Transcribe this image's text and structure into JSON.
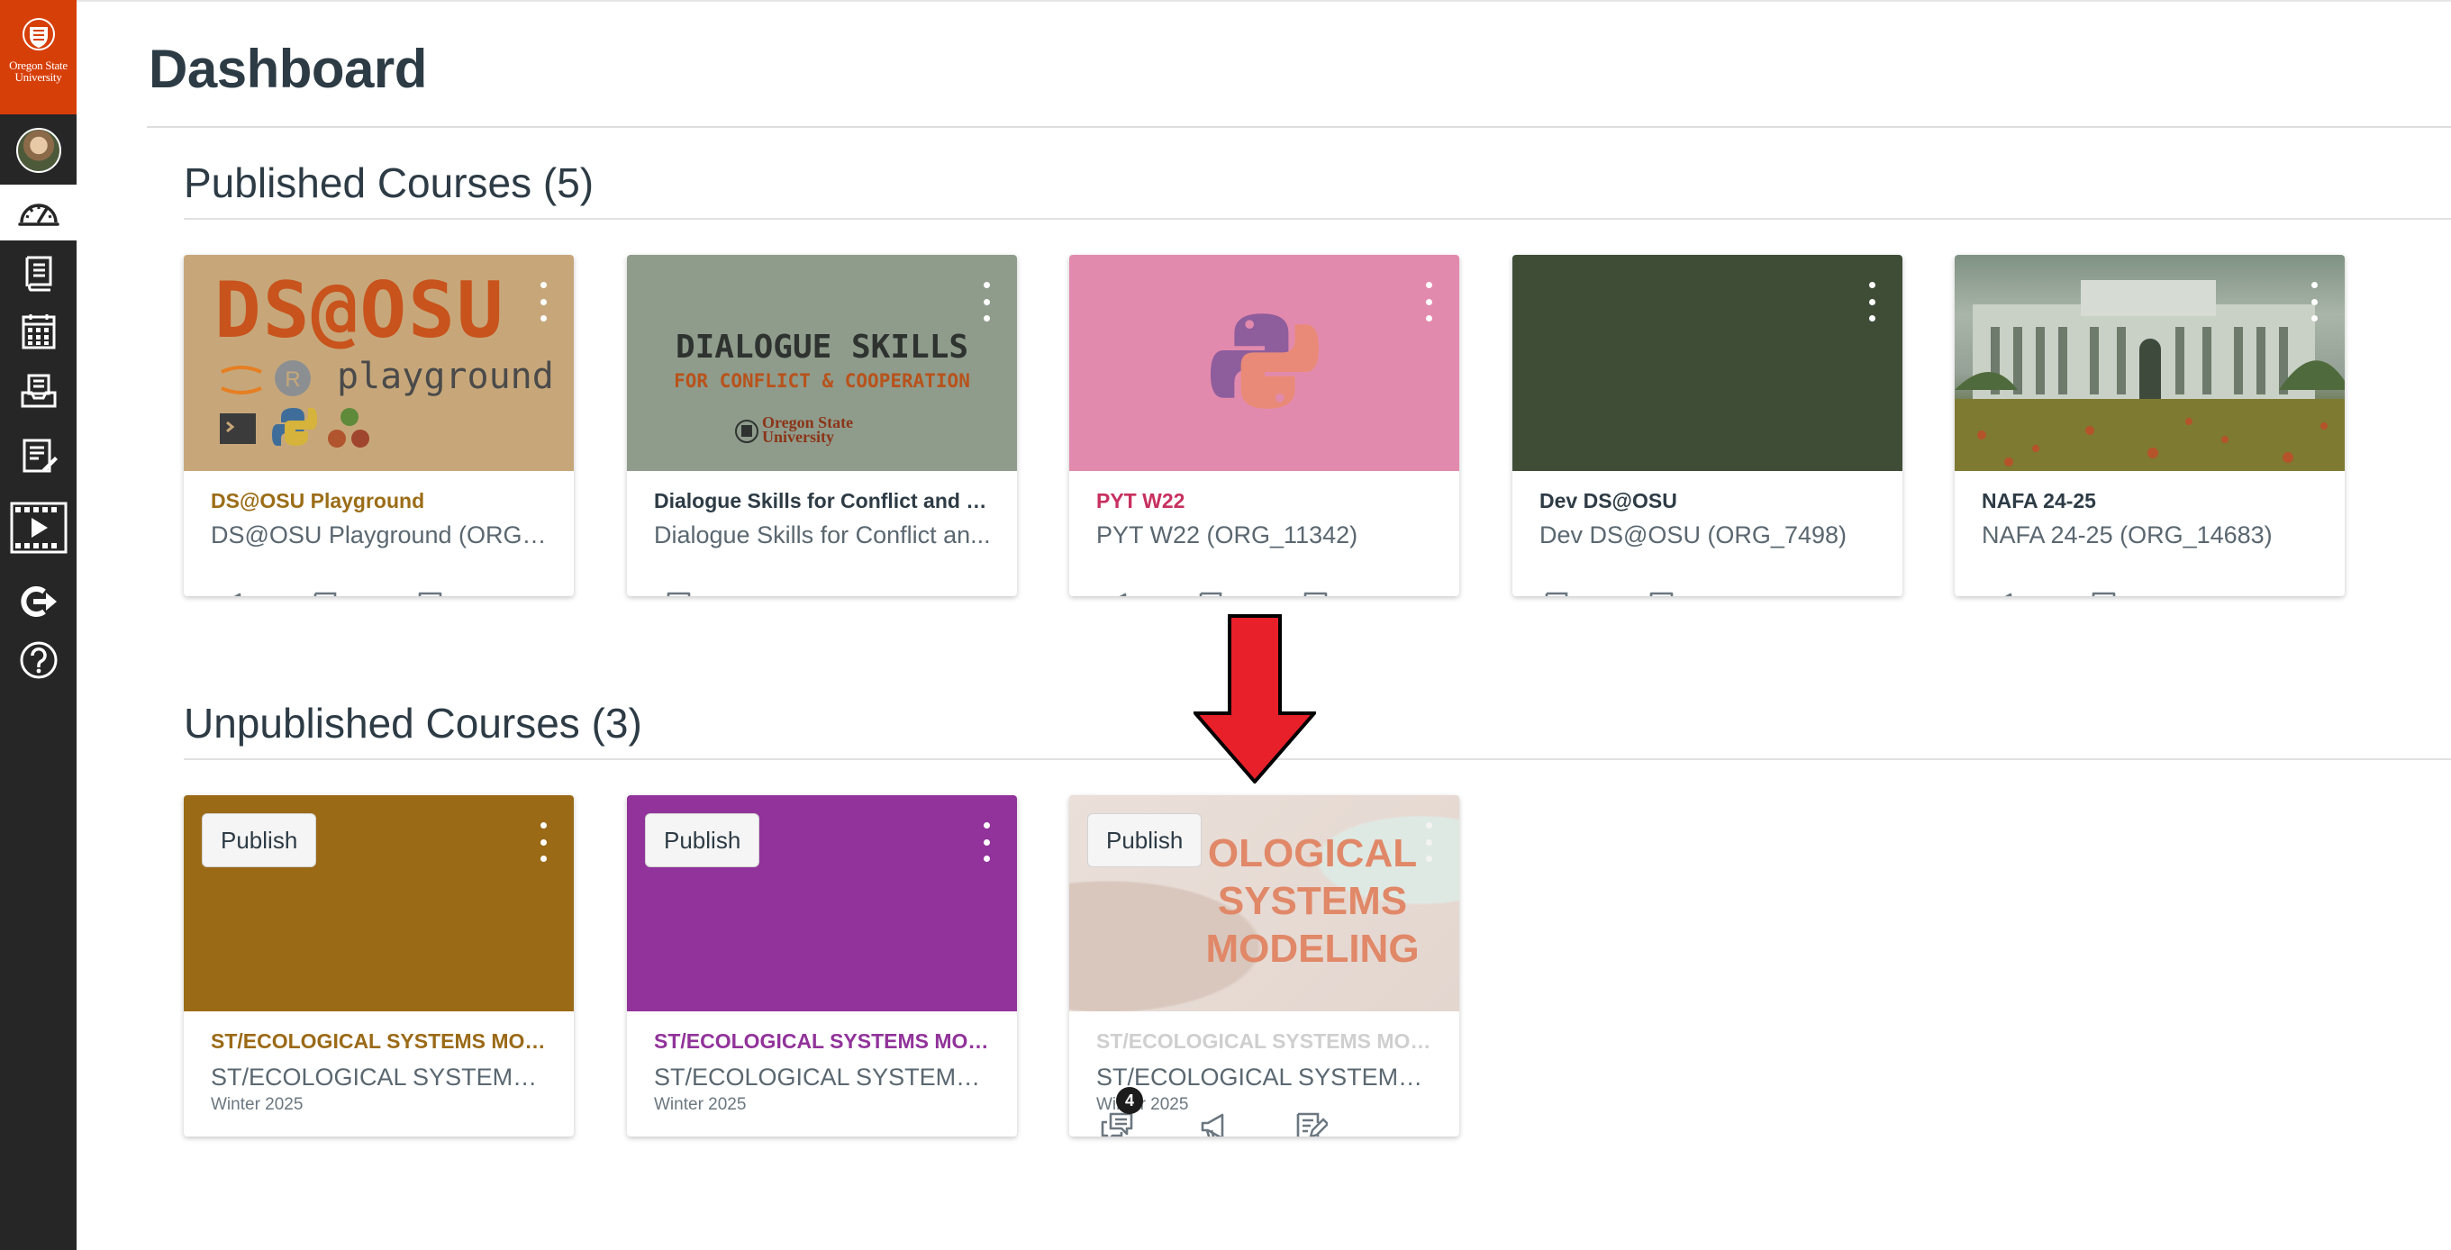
{
  "nav": {
    "logo_line1": "Oregon State",
    "logo_line2": "University",
    "items": [
      {
        "icon": "dashboard-icon"
      },
      {
        "icon": "courses-icon"
      },
      {
        "icon": "calendar-icon"
      },
      {
        "icon": "inbox-icon"
      },
      {
        "icon": "history-icon"
      },
      {
        "icon": "studio-icon"
      },
      {
        "icon": "logout-icon"
      },
      {
        "icon": "help-icon"
      }
    ]
  },
  "page": {
    "title": "Dashboard"
  },
  "published": {
    "heading": "Published Courses (5)",
    "cards": [
      {
        "code": "DS@OSU Playground",
        "name": "DS@OSU Playground (ORG_7...",
        "color": "#9b6d17",
        "hero_big": "DS@OSU",
        "hero_small": "playground",
        "icons": [
          "announcements-icon",
          "assignments-icon",
          "discussions-icon"
        ]
      },
      {
        "code": "Dialogue Skills for Conflict and Co...",
        "name": "Dialogue Skills for Conflict an...",
        "color": "#2d3b45",
        "hero_line1": "DIALOGUE SKILLS",
        "hero_line2": "FOR CONFLICT & COOPERATION",
        "hero_line3": "Oregon State",
        "hero_line4": "University",
        "icons": [
          "discussions-icon"
        ]
      },
      {
        "code": "PYT W22",
        "name": "PYT W22 (ORG_11342)",
        "color": "#c7305f",
        "icons": [
          "announcements-icon",
          "assignments-icon",
          "discussions-icon"
        ]
      },
      {
        "code": "Dev DS@OSU",
        "name": "Dev DS@OSU (ORG_7498)",
        "color": "#2d3b45",
        "icons": [
          "assignments-icon",
          "discussions-icon"
        ]
      },
      {
        "code": "NAFA 24-25",
        "name": "NAFA 24-25 (ORG_14683)",
        "color": "#2d3b45",
        "icons": [
          "announcements-icon",
          "discussions-icon"
        ]
      }
    ]
  },
  "unpublished": {
    "heading": "Unpublished Courses (3)",
    "publish_label": "Publish",
    "cards": [
      {
        "code": "ST/ECOLOGICAL SYSTEMS MOD...",
        "name": "ST/ECOLOGICAL SYSTEMS ...",
        "term": "Winter 2025",
        "color": "#9b6a17",
        "icons": []
      },
      {
        "code": "ST/ECOLOGICAL SYSTEMS MOD...",
        "name": "ST/ECOLOGICAL SYSTEMS ...",
        "term": "Winter 2025",
        "color": "#91339a",
        "icons": []
      },
      {
        "code": "ST/ECOLOGICAL SYSTEMS MOD...",
        "name": "ST/ECOLOGICAL SYSTEMS ...",
        "term": "Winter 2025",
        "color": "#cfcfcf",
        "hero_lines": [
          "OLOGICAL",
          "SYSTEMS",
          "MODELING"
        ],
        "discussion_badge": "4",
        "icons": [
          "discussions-icon",
          "announcements-icon",
          "assignments-icon"
        ]
      }
    ]
  },
  "annotation": {
    "icon": "red-arrow-down",
    "color": "#e8202a"
  }
}
